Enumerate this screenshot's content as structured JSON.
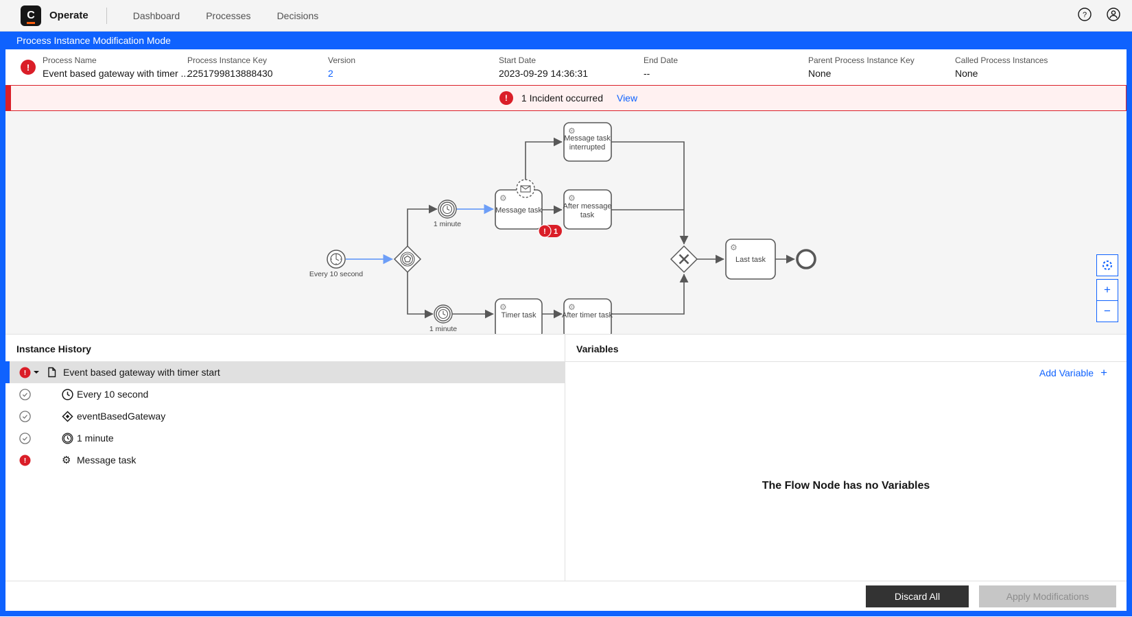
{
  "nav": {
    "logo_letter": "C",
    "brand": "Operate",
    "items": [
      {
        "label": "Dashboard"
      },
      {
        "label": "Processes"
      },
      {
        "label": "Decisions"
      }
    ]
  },
  "banner": {
    "text": "Process Instance Modification Mode"
  },
  "instance_header": {
    "fields": [
      {
        "label": "Process Name",
        "value": "Event based gateway with timer ..."
      },
      {
        "label": "Process Instance Key",
        "value": "2251799813888430"
      },
      {
        "label": "Version",
        "value": "2"
      },
      {
        "label": "Start Date",
        "value": "2023-09-29 14:36:31"
      },
      {
        "label": "End Date",
        "value": "--"
      },
      {
        "label": "Parent Process Instance Key",
        "value": "None"
      },
      {
        "label": "Called Process Instances",
        "value": "None"
      }
    ]
  },
  "incident_bar": {
    "exclamation": "!",
    "text": "1 Incident occurred",
    "action": "View"
  },
  "diagram": {
    "start_event_label": "Every 10 second",
    "timer_top_label": "1 minute",
    "timer_bottom_label": "1 minute",
    "incident_badge": {
      "exclamation": "!",
      "count": "1"
    },
    "tasks": {
      "message_task": {
        "lines": [
          "Message task"
        ]
      },
      "message_task_interrupted": {
        "lines": [
          "Message task",
          "interrupted"
        ]
      },
      "after_message_task": {
        "lines": [
          "After message",
          "task"
        ]
      },
      "timer_task": {
        "lines": [
          "Timer task"
        ]
      },
      "after_timer_task": {
        "lines": [
          "After timer task"
        ]
      },
      "last_task": {
        "lines": [
          "Last task"
        ]
      }
    },
    "controls": {
      "zoom_in": "+",
      "zoom_out": "−"
    }
  },
  "instance_history": {
    "title": "Instance History",
    "rows": [
      {
        "label": "Event based gateway with timer start",
        "state": "incident",
        "icon": "process"
      },
      {
        "label": "Every 10 second",
        "state": "completed",
        "icon": "timer-start"
      },
      {
        "label": "eventBasedGateway",
        "state": "completed",
        "icon": "gateway"
      },
      {
        "label": "1 minute",
        "state": "completed",
        "icon": "timer-intermediate"
      },
      {
        "label": "Message task",
        "state": "incident",
        "icon": "service-task"
      }
    ],
    "exclamation": "!"
  },
  "variables": {
    "title": "Variables",
    "add_label": "Add Variable",
    "add_plus": "+",
    "empty_message": "The Flow Node has no Variables"
  },
  "footer": {
    "discard_label": "Discard All",
    "apply_label": "Apply Modifications"
  },
  "colors": {
    "accent_blue": "#0f62fe",
    "incident_red": "#da1e28",
    "incident_bg": "#fff1f1",
    "flow_highlight": "#6d9ef7"
  }
}
